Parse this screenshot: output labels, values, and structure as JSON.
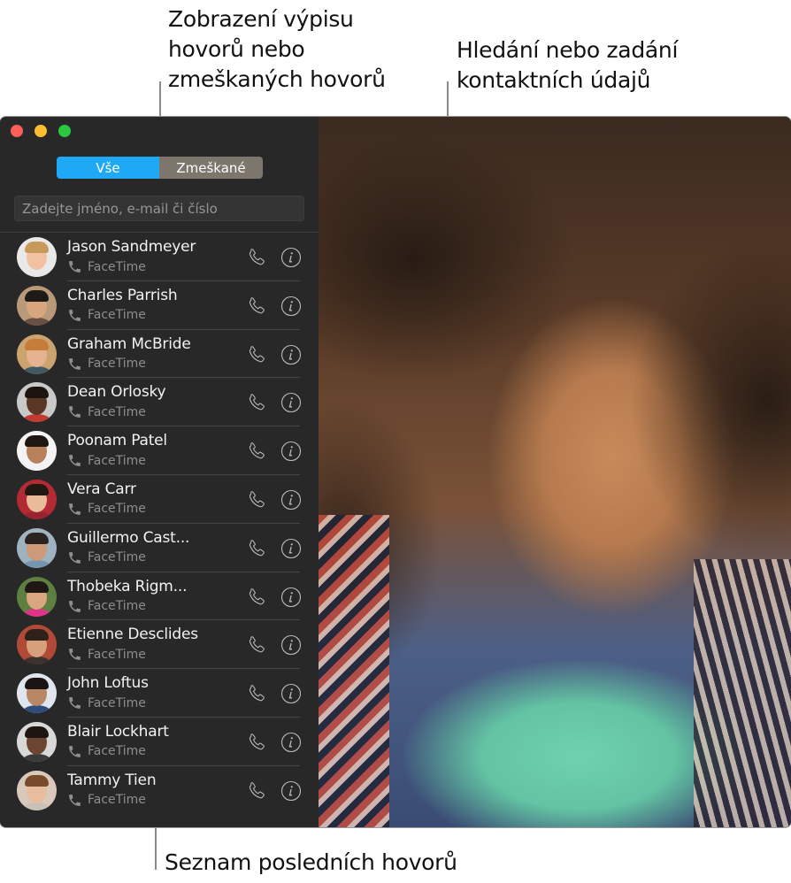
{
  "callouts": {
    "views": [
      "Zobrazení výpisu",
      "hovorů nebo",
      "zmeškaných hovorů"
    ],
    "search": [
      "Hledání nebo zadání",
      "kontaktních údajů"
    ],
    "list": "Seznam posledních hovorů"
  },
  "colors": {
    "accent": "#1fa9f5",
    "segment_inactive": "#7c766c",
    "sidebar_bg": "#282828",
    "close": "#fd5e57",
    "minimize": "#febd2e",
    "zoom": "#29c840"
  },
  "segmented": {
    "all_label": "Vše",
    "missed_label": "Zmeškané",
    "selected": "all"
  },
  "search": {
    "placeholder": "Zadejte jméno, e-mail či číslo",
    "value": ""
  },
  "recents": [
    {
      "name": "Jason Sandmeyer",
      "type": "FaceTime",
      "skin": "#f0c2a2",
      "hair": "#c79a5b",
      "shirt": "#e8e8e8",
      "bg": "#e9e9e9"
    },
    {
      "name": "Charles Parrish",
      "type": "FaceTime",
      "skin": "#d8a67e",
      "hair": "#1e1a18",
      "shirt": "#6a5044",
      "bg": "#b89a7a"
    },
    {
      "name": "Graham McBride",
      "type": "FaceTime",
      "skin": "#e6b391",
      "hair": "#c67c3a",
      "shirt": "#3f5a63",
      "bg": "#caa36e"
    },
    {
      "name": "Dean Orlosky",
      "type": "FaceTime",
      "skin": "#5a3624",
      "hair": "#1b1411",
      "shirt": "#c23a30",
      "bg": "#c9c9c9"
    },
    {
      "name": "Poonam Patel",
      "type": "FaceTime",
      "skin": "#b9805c",
      "hair": "#1f1612",
      "shirt": "#f2f2f2",
      "bg": "#f4f4f4"
    },
    {
      "name": "Vera Carr",
      "type": "FaceTime",
      "skin": "#e9bb9a",
      "hair": "#201813",
      "shirt": "#9b2230",
      "bg": "#b22a34"
    },
    {
      "name": "Guillermo Cast...",
      "type": "FaceTime",
      "skin": "#cc9a78",
      "hair": "#2c2320",
      "shirt": "#7696b0",
      "bg": "#9fb2c0"
    },
    {
      "name": "Thobeka Rigm...",
      "type": "FaceTime",
      "skin": "#d9a682",
      "hair": "#1e1714",
      "shirt": "#e2338a",
      "bg": "#5d8040"
    },
    {
      "name": "Etienne Desclides",
      "type": "FaceTime",
      "skin": "#d7a07d",
      "hair": "#2d211a",
      "shirt": "#3c3230",
      "bg": "#b04a36"
    },
    {
      "name": "John Loftus",
      "type": "FaceTime",
      "skin": "#b88764",
      "hair": "#1a1512",
      "shirt": "#2e4d7a",
      "bg": "#dfe6ee"
    },
    {
      "name": "Blair Lockhart",
      "type": "FaceTime",
      "skin": "#6b4432",
      "hair": "#1d1512",
      "shirt": "#3a3a3a",
      "bg": "#d8d8d8"
    },
    {
      "name": "Tammy Tien",
      "type": "FaceTime",
      "skin": "#e8bc9f",
      "hair": "#7a4a2c",
      "shirt": "#c9c1b8",
      "bg": "#d9c9bb"
    }
  ],
  "icons": {
    "call_button": "phone-outline-icon",
    "info_button": "info-circle-icon",
    "subtitle": "phone-filled-icon"
  }
}
